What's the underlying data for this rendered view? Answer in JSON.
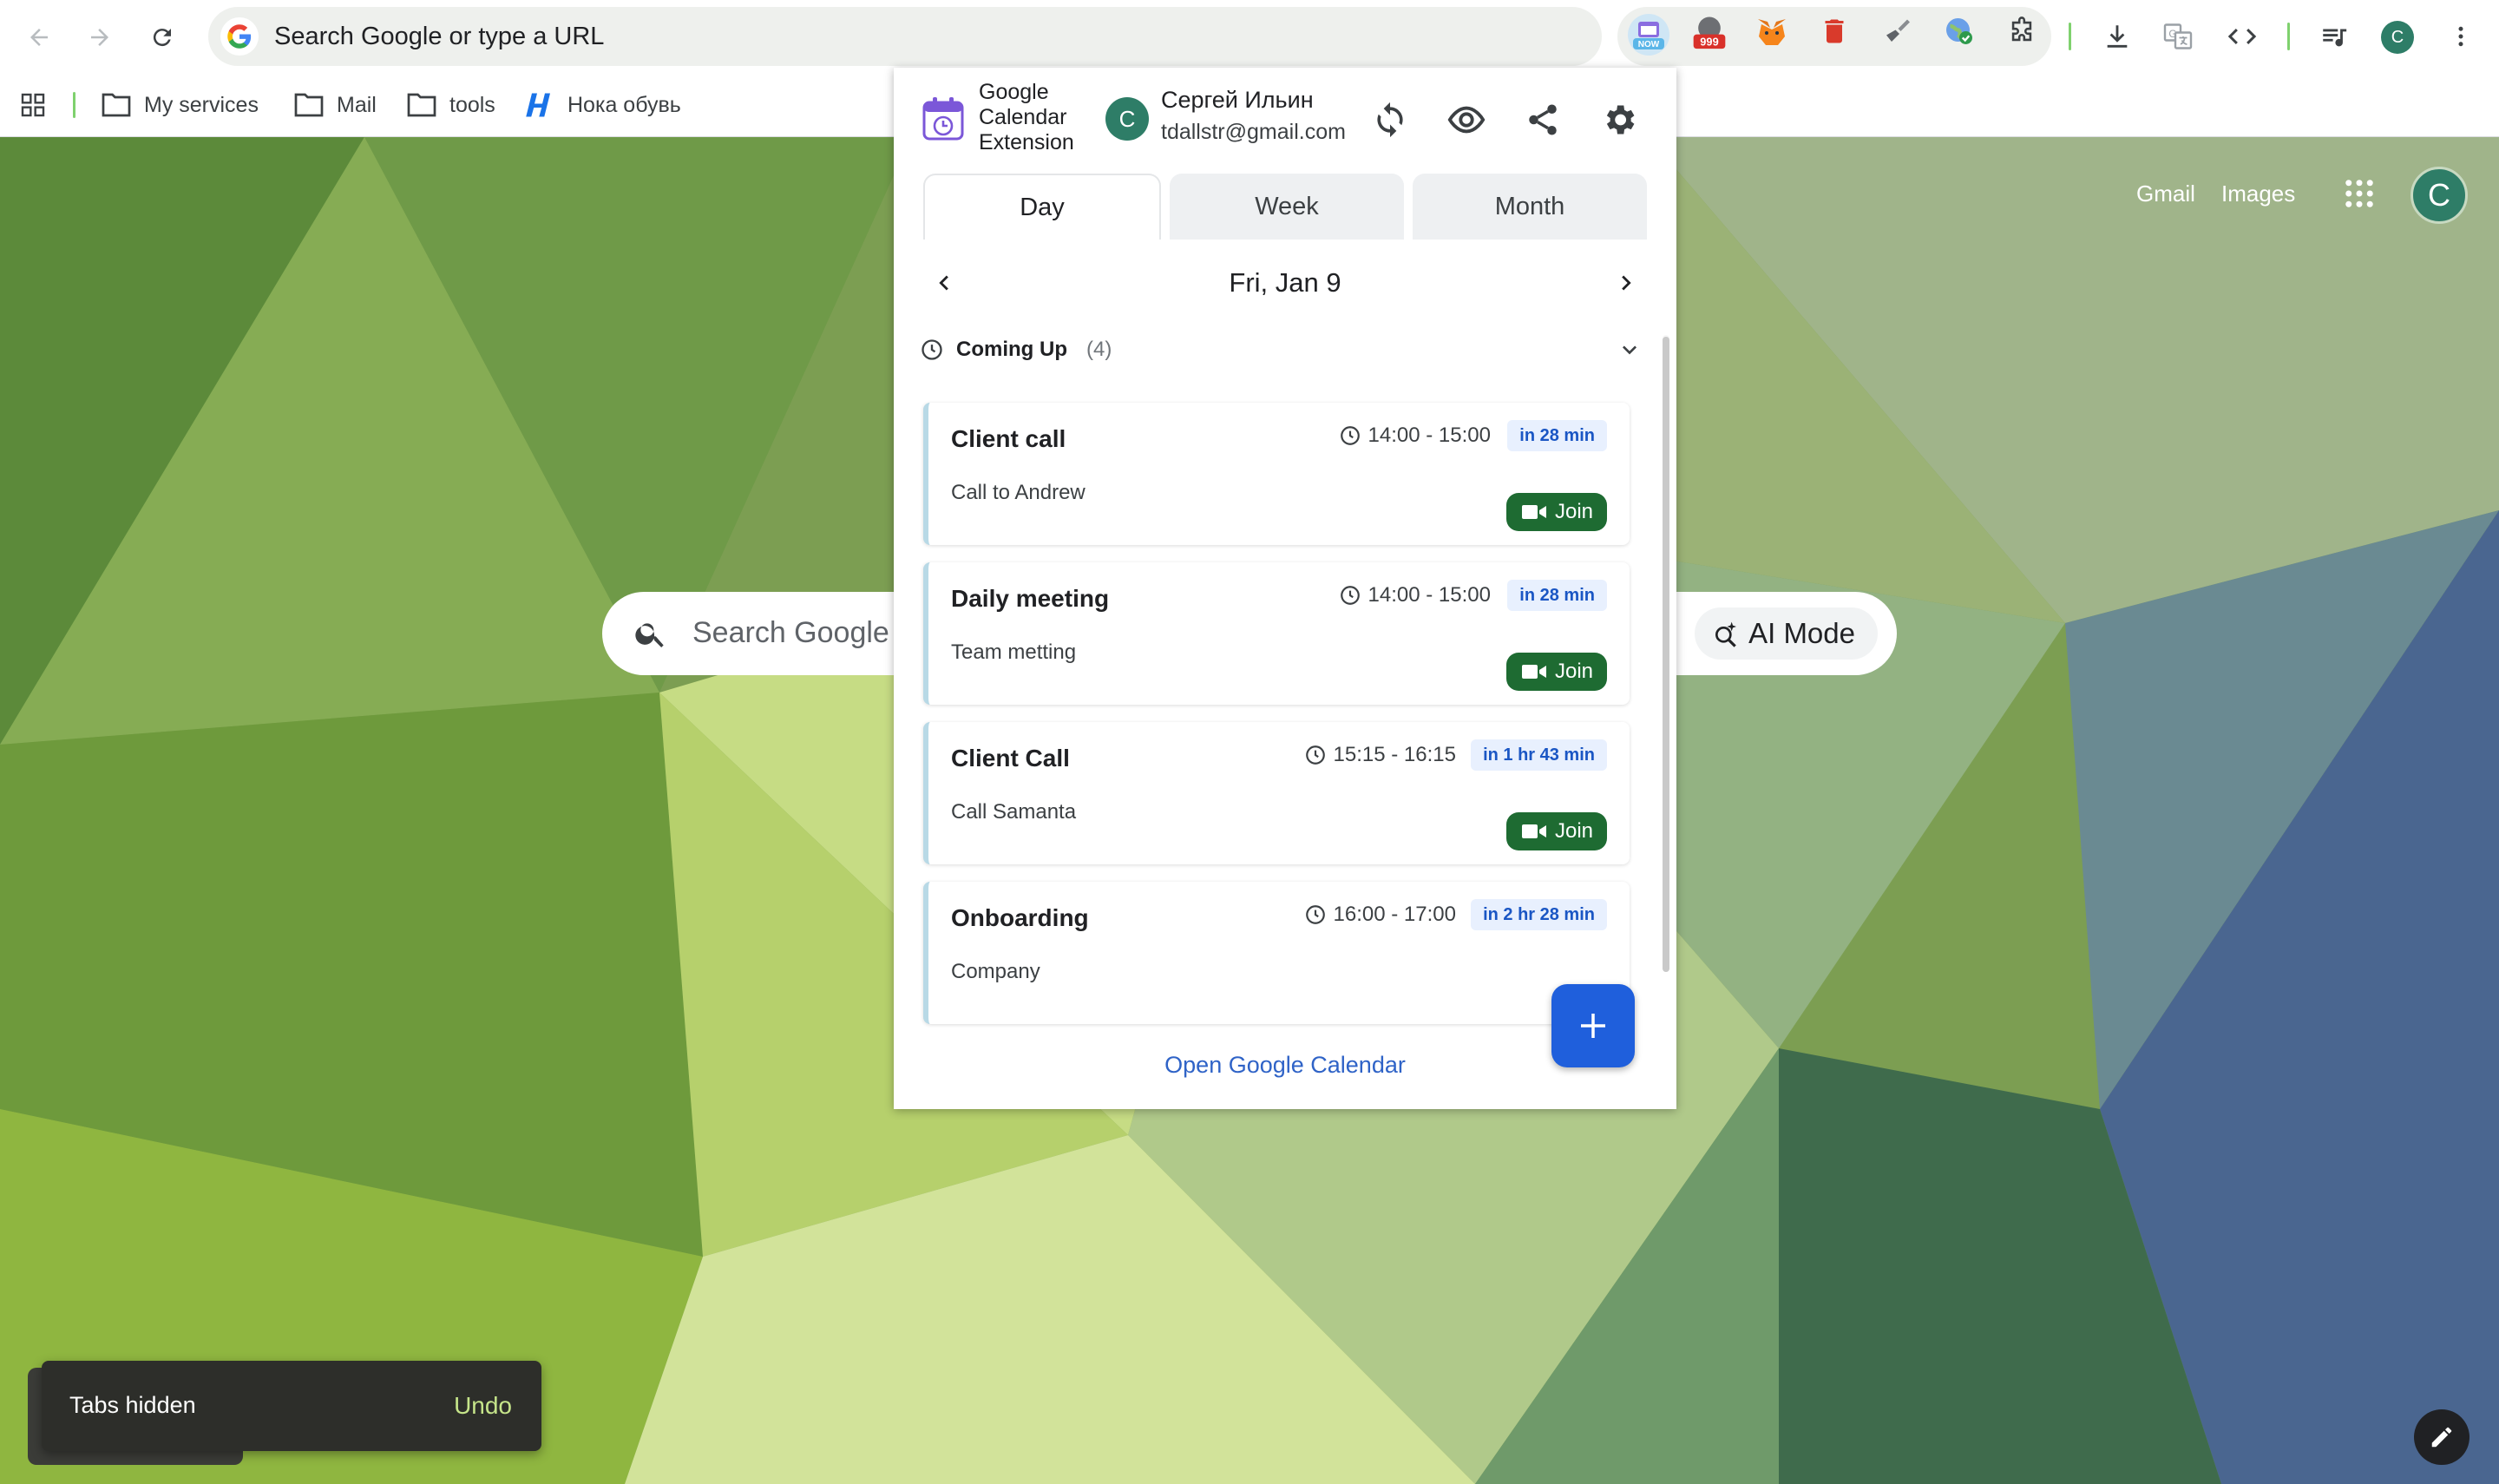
{
  "browser": {
    "omnibox_text": "Search Google or type a URL",
    "extensions": [
      {
        "name": "calendar-now-extension",
        "badge": "NOW"
      },
      {
        "name": "ad-counter-extension",
        "badge": "999"
      },
      {
        "name": "metamask-fox-extension"
      },
      {
        "name": "trash-extension"
      },
      {
        "name": "broom-extension"
      },
      {
        "name": "globe-check-extension"
      },
      {
        "name": "puzzle-extensions-menu"
      }
    ],
    "profile_initial": "C",
    "bookmarks": [
      "My services",
      "Mail",
      "tools",
      "Нока обувь"
    ]
  },
  "newtab": {
    "gmail": "Gmail",
    "images": "Images",
    "avatar": "C",
    "search_placeholder": "Search Google or type a URL",
    "ai_mode": "AI Mode",
    "toast_message": "Tabs hidden",
    "toast_undo": "Undo"
  },
  "popup": {
    "app_title": "Google Calendar Extension",
    "user": {
      "initial": "C",
      "name": "Сергей Ильин",
      "email": "tdallstr@gmail.com"
    },
    "tabs": [
      "Day",
      "Week",
      "Month"
    ],
    "active_tab": "Day",
    "date_label": "Fri, Jan 9",
    "section_title": "Coming Up",
    "section_count": "(4)",
    "events": [
      {
        "title": "Client call",
        "time": "14:00 - 15:00",
        "badge": "in 28 min",
        "desc": "Call to Andrew",
        "join": "Join"
      },
      {
        "title": "Daily meeting",
        "time": "14:00 - 15:00",
        "badge": "in 28 min",
        "desc": "Team metting",
        "join": "Join"
      },
      {
        "title": "Client Call",
        "time": "15:15 - 16:15",
        "badge": "in 1 hr 43 min",
        "desc": "Call Samanta",
        "join": "Join"
      },
      {
        "title": "Onboarding",
        "time": "16:00 - 17:00",
        "badge": "in 2 hr 28 min",
        "desc": "Company"
      }
    ],
    "open_calendar": "Open Google Calendar",
    "colors": {
      "join_green": "#1e6b32",
      "fab_blue": "#1f5fdc",
      "badge_text": "#1a56c4",
      "accent_border": "#b8d9e6"
    }
  }
}
